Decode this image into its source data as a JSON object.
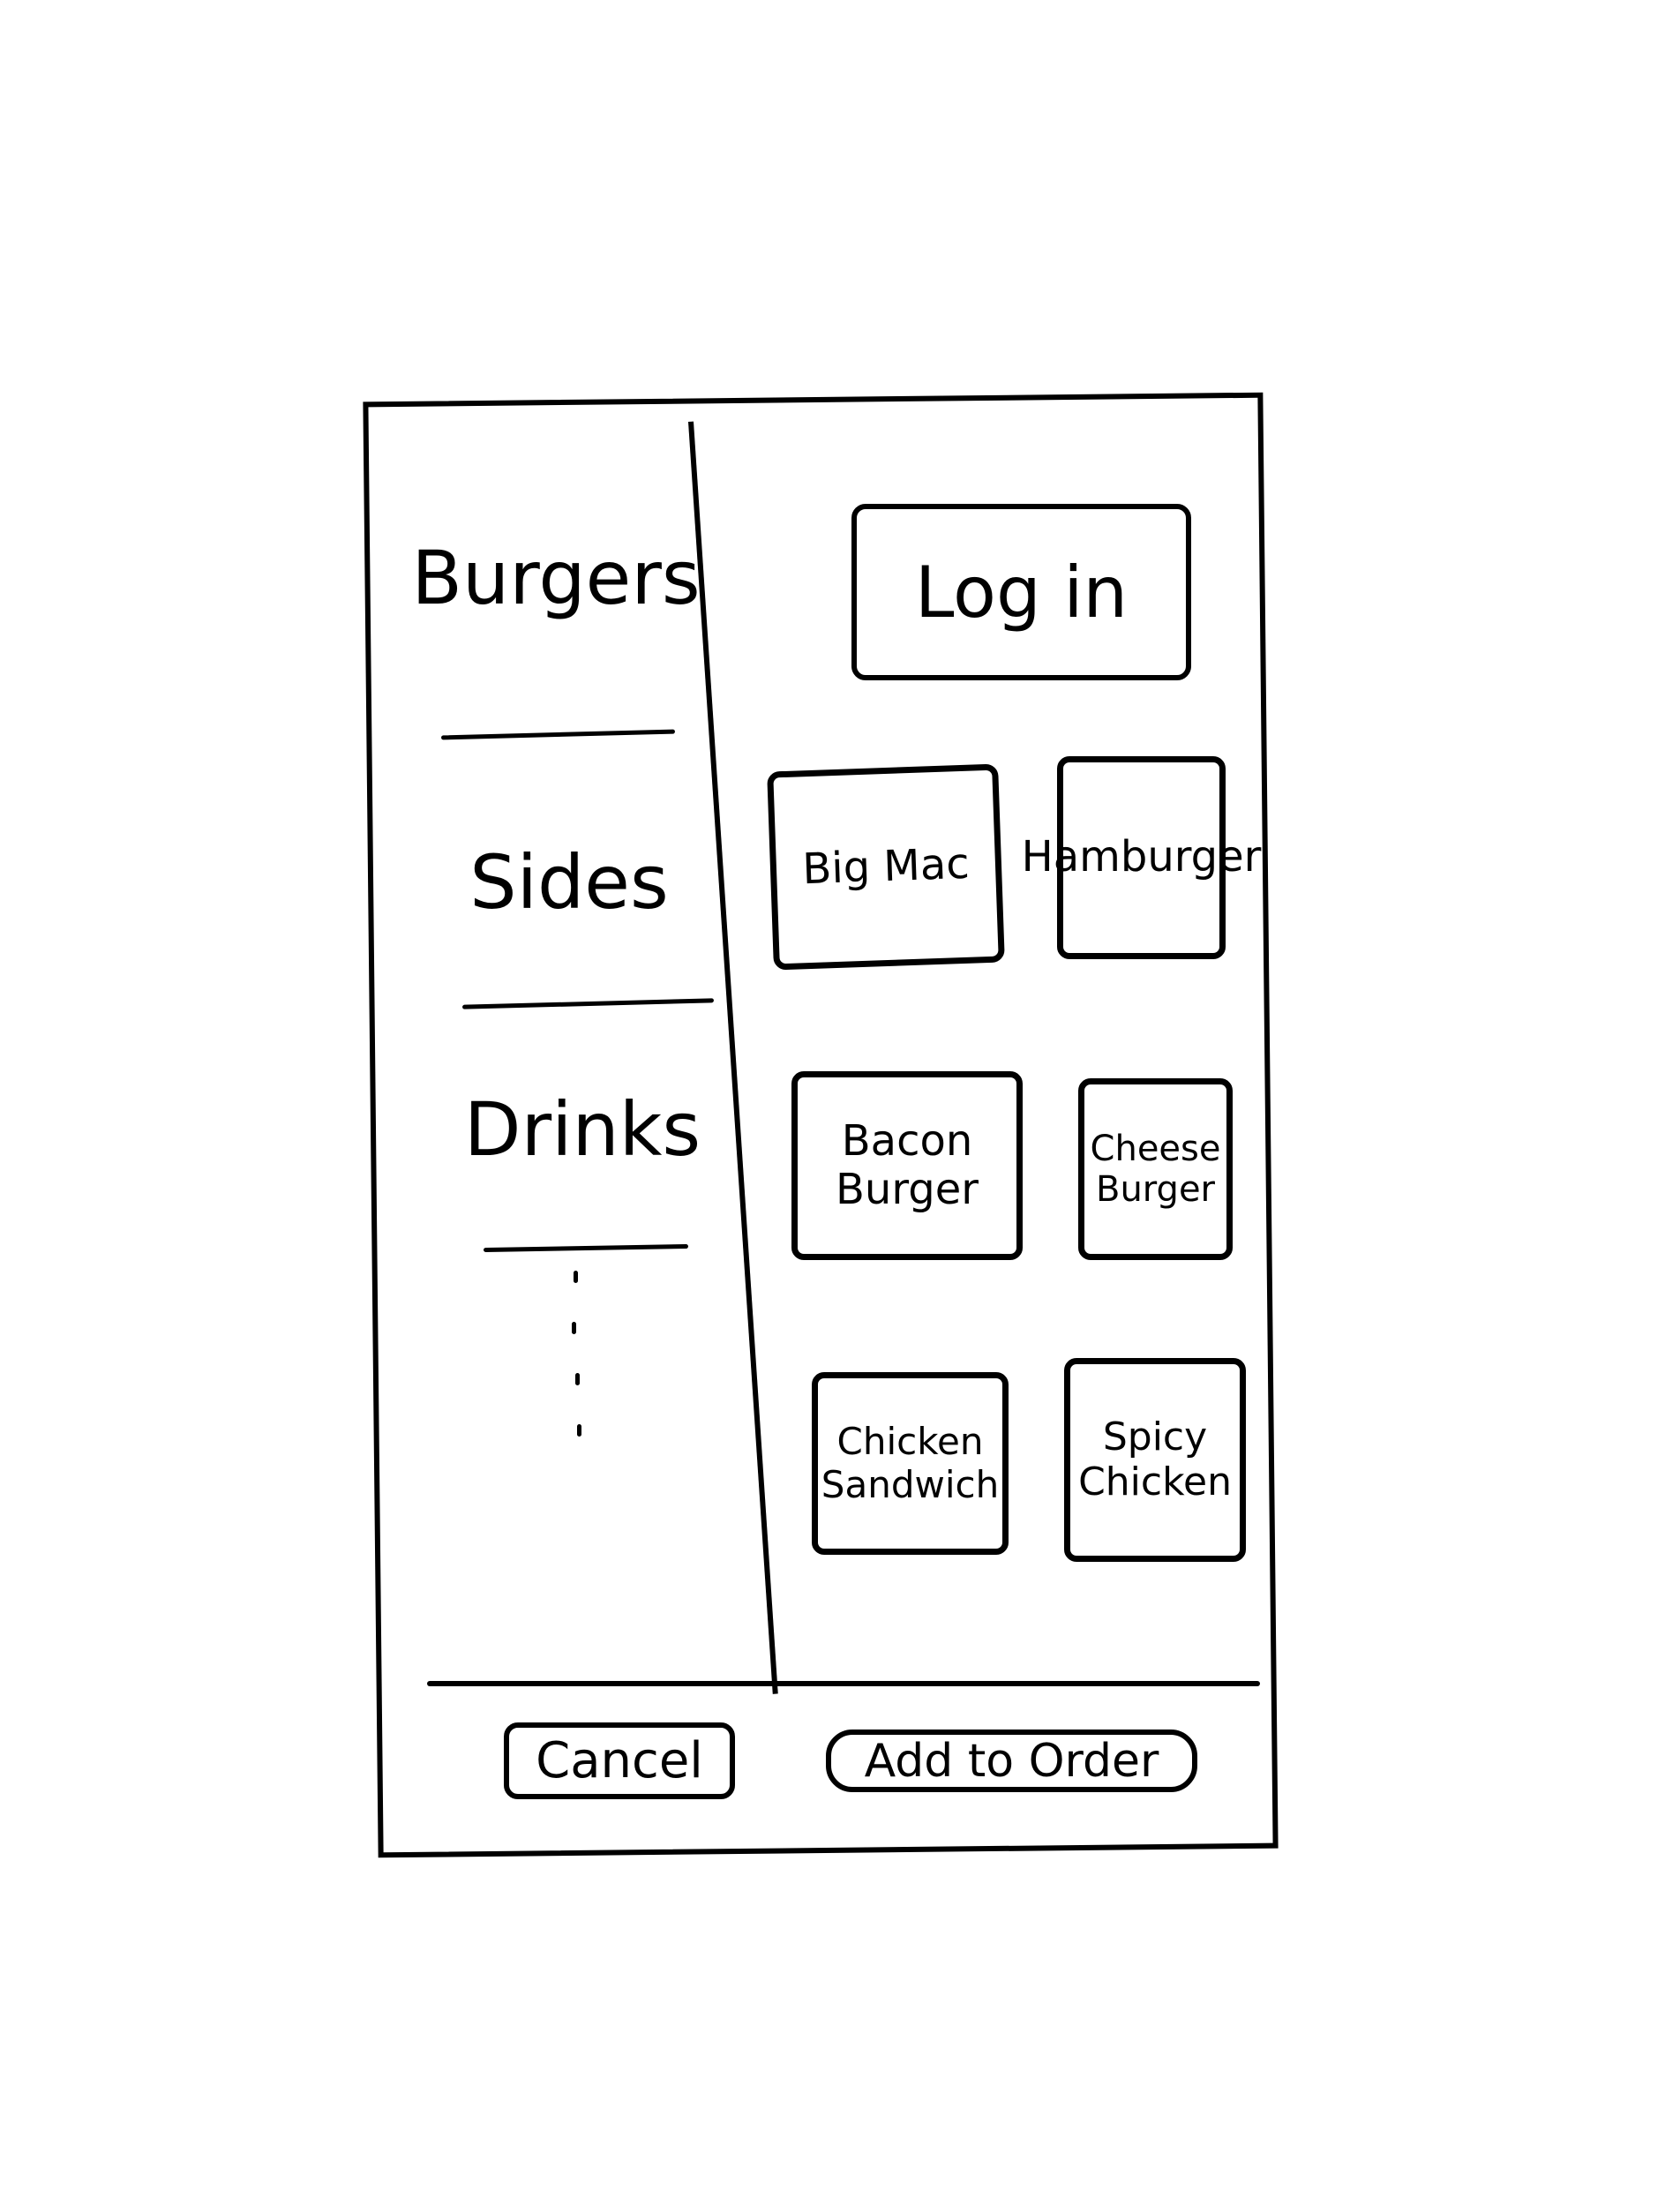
{
  "sidebar": {
    "categories": [
      {
        "label": "Burgers"
      },
      {
        "label": "Sides"
      },
      {
        "label": "Drinks"
      }
    ],
    "more_indicator": "more-dots"
  },
  "header": {
    "login_label": "Log in"
  },
  "menu": {
    "items": [
      {
        "label": "Big Mac"
      },
      {
        "label": "Hamburger"
      },
      {
        "label": "Bacon Burger"
      },
      {
        "label": "Cheese Burger"
      },
      {
        "label": "Chicken Sandwich"
      },
      {
        "label": "Spicy Chicken"
      }
    ]
  },
  "footer": {
    "cancel_label": "Cancel",
    "add_label": "Add to Order"
  }
}
